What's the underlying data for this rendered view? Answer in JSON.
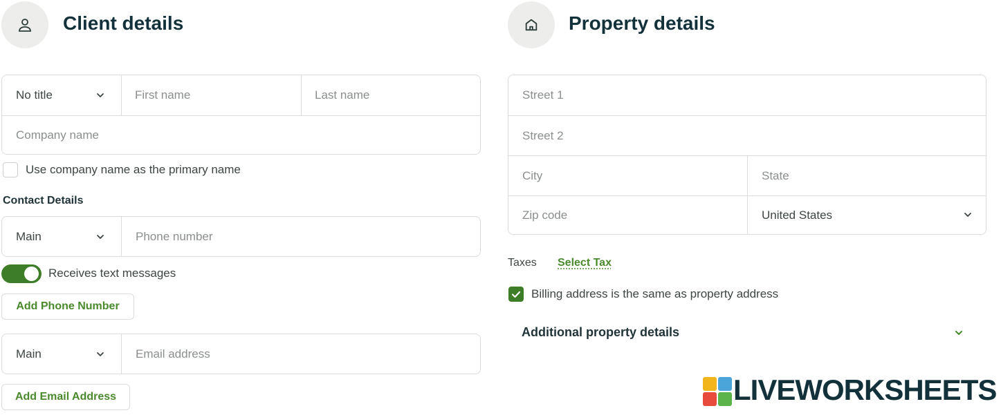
{
  "client": {
    "title": "Client details",
    "icon": "person-icon",
    "title_select": "No title",
    "first_name_placeholder": "First name",
    "last_name_placeholder": "Last name",
    "company_placeholder": "Company name",
    "use_company_label": "Use company name as the primary name",
    "use_company_checked": false,
    "contact_heading": "Contact Details",
    "phone_type": "Main",
    "phone_placeholder": "Phone number",
    "text_messages_label": "Receives text messages",
    "text_messages_on": true,
    "add_phone_label": "Add Phone Number",
    "email_type": "Main",
    "email_placeholder": "Email address",
    "add_email_label": "Add Email Address"
  },
  "property": {
    "title": "Property details",
    "icon": "house-icon",
    "street1_placeholder": "Street 1",
    "street2_placeholder": "Street 2",
    "city_placeholder": "City",
    "state_placeholder": "State",
    "zip_placeholder": "Zip code",
    "country": "United States",
    "taxes_label": "Taxes",
    "select_tax_label": "Select Tax",
    "billing_same_label": "Billing address is the same as property address",
    "billing_same_checked": true,
    "additional_label": "Additional property details"
  },
  "watermark": {
    "text": "LIVEWORKSHEETS"
  },
  "colors": {
    "accent_green": "#4a8a2c",
    "toggle_green": "#3e7d27",
    "heading": "#12313a",
    "border": "#dcdcdc",
    "icon_bg": "#ededeb"
  }
}
